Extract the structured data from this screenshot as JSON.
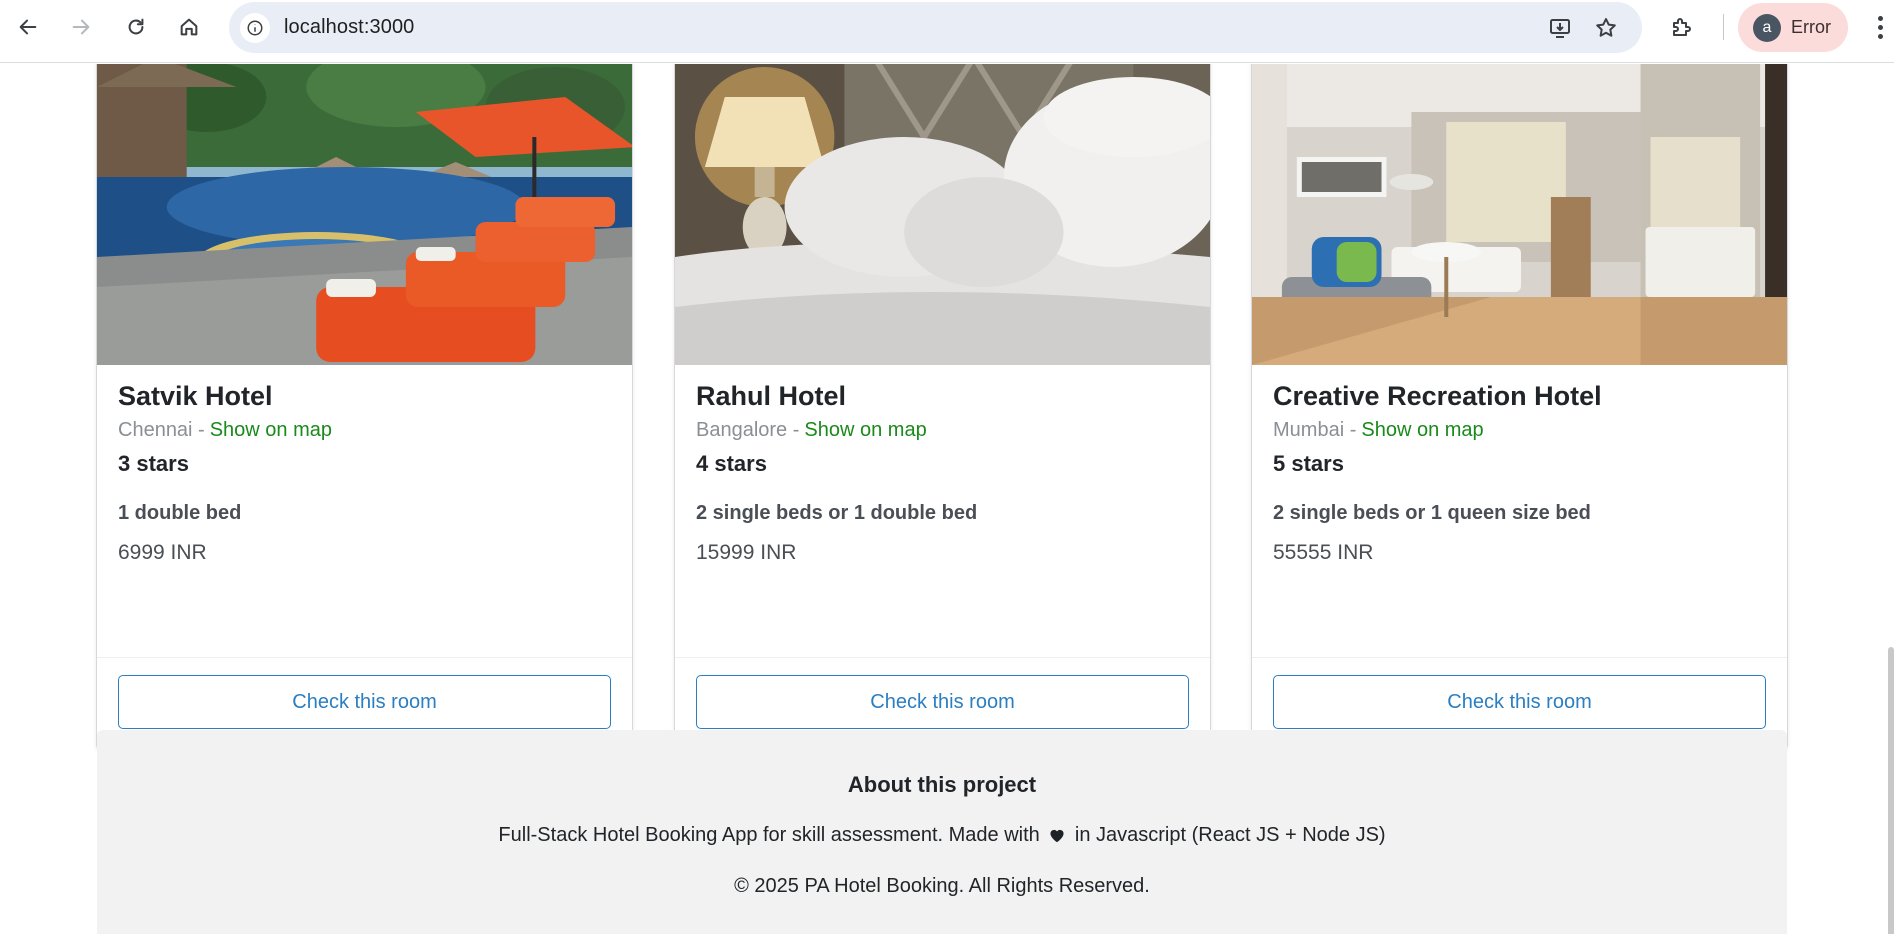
{
  "browser": {
    "url": "localhost:3000",
    "profile_initial": "a",
    "profile_status": "Error"
  },
  "hotels": [
    {
      "name": "Satvik Hotel",
      "city": "Chennai -",
      "map_link": "Show on map",
      "stars": "3 stars",
      "beds": "1 double bed",
      "price": "6999 INR",
      "button": "Check this room"
    },
    {
      "name": "Rahul Hotel",
      "city": "Bangalore -",
      "map_link": "Show on map",
      "stars": "4 stars",
      "beds": "2 single beds or 1 double bed",
      "price": "15999 INR",
      "button": "Check this room"
    },
    {
      "name": "Creative Recreation Hotel",
      "city": "Mumbai -",
      "map_link": "Show on map",
      "stars": "5 stars",
      "beds": "2 single beds or 1 queen size bed",
      "price": "55555 INR",
      "button": "Check this room"
    }
  ],
  "about": {
    "title": "About this project",
    "desc_before": "Full-Stack Hotel Booking App for skill assessment. Made with",
    "desc_after": "in Javascript (React JS + Node JS)",
    "copyright": "© 2025 PA Hotel Booking. All Rights Reserved."
  },
  "colors": {
    "link_green": "#1a8a1a",
    "button_blue": "#2a7ec2",
    "footer_bg": "#f2f2f2",
    "profile_chip": "#fbdcda"
  },
  "icons": {
    "back": "arrow-left-icon",
    "forward": "arrow-right-icon",
    "reload": "reload-icon",
    "home": "home-icon",
    "site_info": "info-icon",
    "install": "install-app-icon",
    "bookmark": "star-icon",
    "extensions": "puzzle-icon",
    "menu": "kebab-menu-icon",
    "heart": "heart-icon"
  }
}
